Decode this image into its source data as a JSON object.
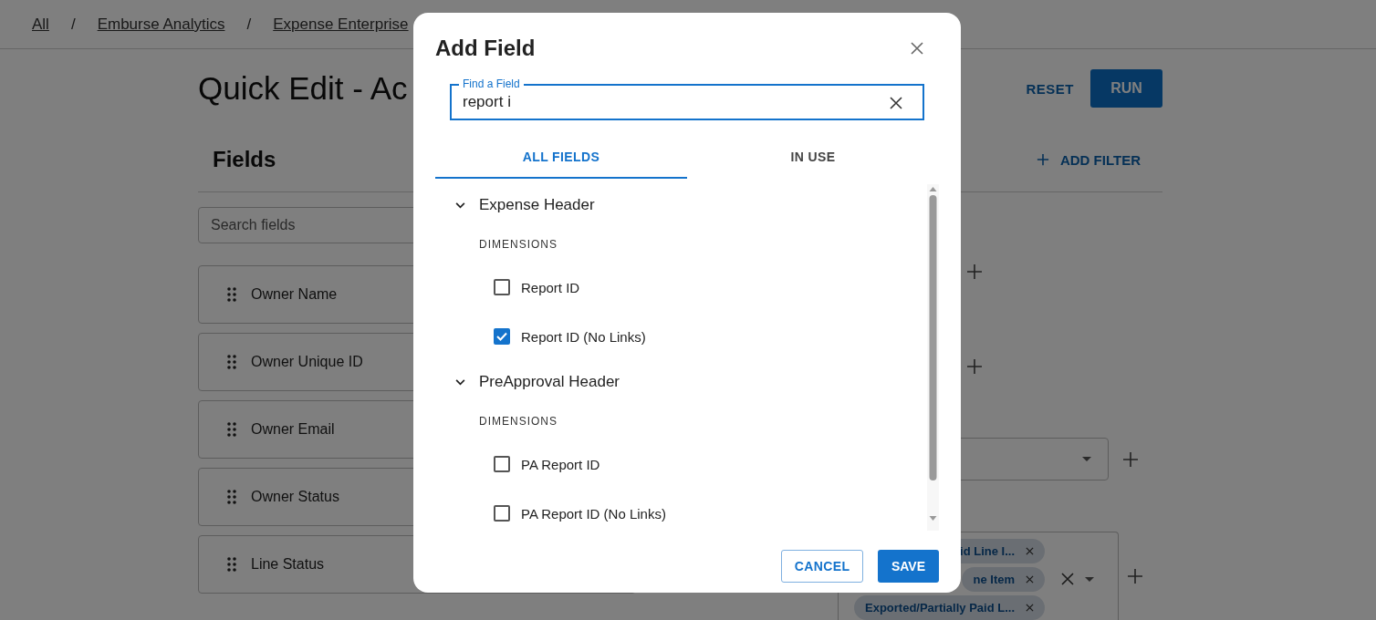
{
  "breadcrumbs": [
    {
      "kind": "link",
      "text": "All"
    },
    {
      "kind": "separator",
      "text": "/"
    },
    {
      "kind": "link",
      "text": "Emburse Analytics"
    },
    {
      "kind": "separator",
      "text": "/"
    },
    {
      "kind": "link",
      "text": "Expense Enterprise"
    }
  ],
  "page": {
    "title": "Quick Edit - Ac",
    "reset_button": "RESET",
    "run_button": "RUN"
  },
  "fields_panel": {
    "heading": "Fields",
    "search": {
      "placeholder": "Search fields"
    },
    "items": [
      "Owner Name",
      "Owner Unique ID",
      "Owner Email",
      "Owner Status",
      "Line Status"
    ]
  },
  "filters": {
    "add_filter": "ADD FILTER",
    "chips": [
      "id Line I...",
      "ne Item",
      "Exported/Partially Paid L..."
    ]
  },
  "modal": {
    "title": "Add Field",
    "search": {
      "label": "Find a Field",
      "value": "report i"
    },
    "tabs": [
      {
        "label": "ALL FIELDS",
        "selected": true
      },
      {
        "label": "IN USE",
        "selected": false
      }
    ],
    "groups": [
      {
        "name": "Expense Header",
        "expanded": true,
        "sections": [
          {
            "heading": "DIMENSIONS",
            "items": [
              {
                "label": "Report ID",
                "checked": false
              },
              {
                "label": "Report ID (No Links)",
                "checked": true
              }
            ]
          }
        ]
      },
      {
        "name": "PreApproval Header",
        "expanded": true,
        "sections": [
          {
            "heading": "DIMENSIONS",
            "items": [
              {
                "label": "PA Report ID",
                "checked": false
              },
              {
                "label": "PA Report ID (No Links)",
                "checked": false
              }
            ]
          }
        ]
      }
    ],
    "cancel_button": "CANCEL",
    "save_button": "SAVE"
  }
}
